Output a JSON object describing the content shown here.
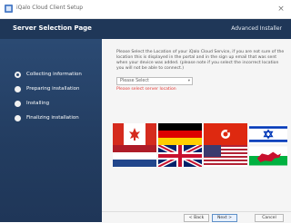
{
  "window": {
    "title": "iQalo Cloud Client Setup",
    "close_glyph": "×"
  },
  "header": {
    "title": "Server Selection Page",
    "right_text": "Advanced Installer"
  },
  "sidebar": {
    "steps": [
      {
        "label": "Collecting information",
        "active": true
      },
      {
        "label": "Preparing installation",
        "active": false
      },
      {
        "label": "Installing",
        "active": false
      },
      {
        "label": "Finalizing installation",
        "active": false
      }
    ]
  },
  "content": {
    "instructions": "Please Select the Location of your iQalo Cloud Service, if you are not sure of the location this is displayed in the portal and in the sign up email that was sent when your device was added. (please note if you select the incorrect location you will not be able to connect.)",
    "select": {
      "value": "Please Select",
      "arrow": "▾"
    },
    "error": "Please select server location"
  },
  "flags": [
    {
      "country": "Canada"
    },
    {
      "country": "Germany"
    },
    {
      "country": "Hong Kong"
    },
    {
      "country": "Israel"
    },
    {
      "country": "Netherlands"
    },
    {
      "country": "United Kingdom"
    },
    {
      "country": "United States"
    },
    {
      "country": "Wales"
    }
  ],
  "footer": {
    "back": "< Back",
    "next": "Next >",
    "cancel": "Cancel"
  },
  "colors": {
    "header_bg": "#1f3758",
    "sidebar_bg": "#2b4a73",
    "error": "#e53935"
  }
}
